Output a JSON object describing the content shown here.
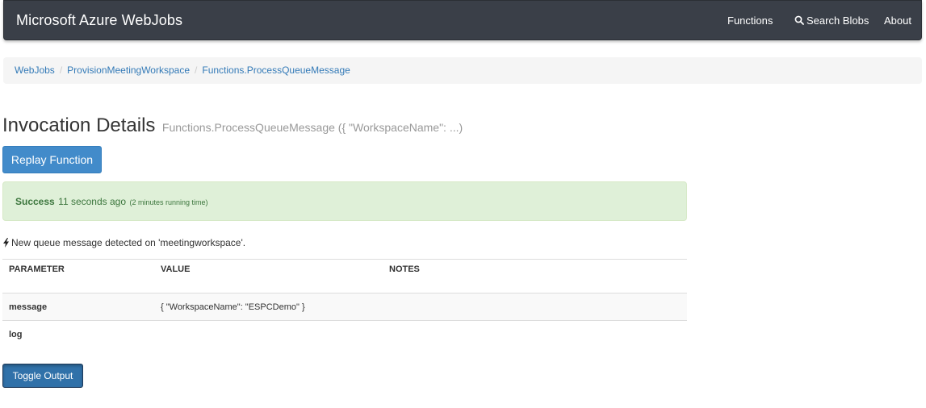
{
  "navbar": {
    "brand": "Microsoft Azure WebJobs",
    "links": {
      "functions": "Functions",
      "search_blobs": "Search Blobs",
      "about": "About"
    }
  },
  "breadcrumb": {
    "items": [
      "WebJobs",
      "ProvisionMeetingWorkspace",
      "Functions.ProcessQueueMessage"
    ],
    "separator": "/"
  },
  "heading": {
    "title": "Invocation Details",
    "subtitle": "Functions.ProcessQueueMessage ({ \"WorkspaceName\": ...)"
  },
  "buttons": {
    "replay": "Replay Function",
    "toggle_output": "Toggle Output"
  },
  "status": {
    "label": "Success",
    "time": "11 seconds ago",
    "duration": "(2 minutes running time)",
    "color": "#3c763d"
  },
  "trigger": {
    "icon": "bolt-icon",
    "text": "New queue message detected on 'meetingworkspace'."
  },
  "table": {
    "headers": [
      "PARAMETER",
      "VALUE",
      "NOTES"
    ],
    "rows": [
      {
        "parameter": "message",
        "value": "{ \"WorkspaceName\": \"ESPCDemo\" }",
        "notes": ""
      },
      {
        "parameter": "log",
        "value": "",
        "notes": ""
      }
    ]
  },
  "colors": {
    "navbar_bg": "#3a3f48",
    "link": "#337ab7",
    "primary_button": "#428bca",
    "success_bg": "#dff0d8"
  }
}
